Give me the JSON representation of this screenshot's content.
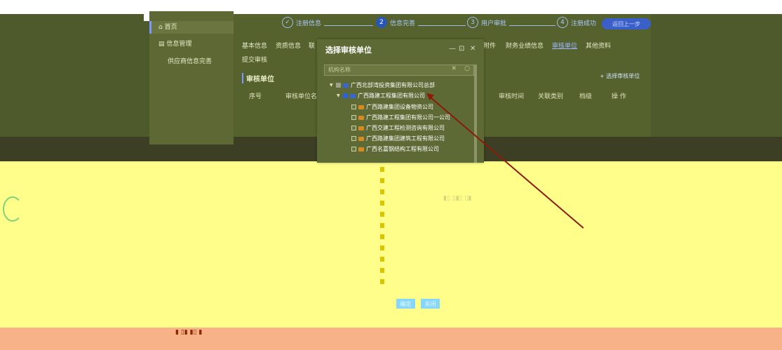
{
  "sidebar": {
    "items": [
      {
        "label": "首页",
        "icon": "home-icon",
        "active": true
      },
      {
        "label": "信息管理",
        "icon": "document-icon",
        "active": false
      }
    ],
    "sub_item": "供应商信息完善"
  },
  "steps": [
    {
      "number": "1",
      "label": "注册信息",
      "status": "done"
    },
    {
      "number": "2",
      "label": "信息完善",
      "status": "active"
    },
    {
      "number": "3",
      "label": "用户审批",
      "status": "todo"
    },
    {
      "number": "4",
      "label": "注册成功",
      "status": "todo"
    }
  ],
  "header": {
    "back_label": "返回上一步"
  },
  "tabs": [
    {
      "label": "基本信息",
      "active": false
    },
    {
      "label": "资质信息",
      "active": false
    },
    {
      "label": "联",
      "active": false
    },
    {
      "label": "附件",
      "active": false
    },
    {
      "label": "财务业绩信息",
      "active": false
    },
    {
      "label": "审核单位",
      "active": true
    },
    {
      "label": "其他资料",
      "active": false
    }
  ],
  "submit_review": "提交审核",
  "section": {
    "title": "审核单位",
    "add_button": "+ 选择审核单位",
    "columns": [
      "序号",
      "审核单位名",
      "审核时间",
      "关联类别",
      "档级",
      "操 作"
    ]
  },
  "modal": {
    "title": "选择审核单位",
    "controls": {
      "minimize": "—",
      "maximize": "⊡",
      "close": "✕"
    },
    "search_placeholder": "机构名称",
    "search_clear": "✕",
    "tree": [
      {
        "label": "广西北部湾投资集团有限公司总部",
        "level": 0,
        "expanded": true,
        "checkbox": "partial",
        "folder_color": "blue"
      },
      {
        "label": "广西路建工程集团有限公司",
        "level": 1,
        "expanded": true,
        "checkbox": "checked",
        "folder_color": "blue"
      },
      {
        "label": "广西路建集团设备物资公司",
        "level": 2,
        "checkbox": "unchecked",
        "folder_color": "orange"
      },
      {
        "label": "广西路建工程集团有限公司一公司",
        "level": 2,
        "checkbox": "unchecked",
        "folder_color": "orange"
      },
      {
        "label": "广西交建工程检测咨询有限公司",
        "level": 2,
        "checkbox": "unchecked",
        "folder_color": "orange"
      },
      {
        "label": "广西路建集团建筑工程有限公司",
        "level": 2,
        "checkbox": "unchecked",
        "folder_color": "orange"
      },
      {
        "label": "广西名嘉钢结构工程有限公司",
        "level": 2,
        "checkbox": "unchecked",
        "folder_color": "orange"
      }
    ],
    "confirm_label": "确定",
    "cancel_label": "关闭"
  },
  "colors": {
    "accent": "#2a56b6",
    "arrow": "#8b1b08",
    "overlay_yellow": "#fffe8a",
    "overlay_salmon": "#f8b288"
  }
}
